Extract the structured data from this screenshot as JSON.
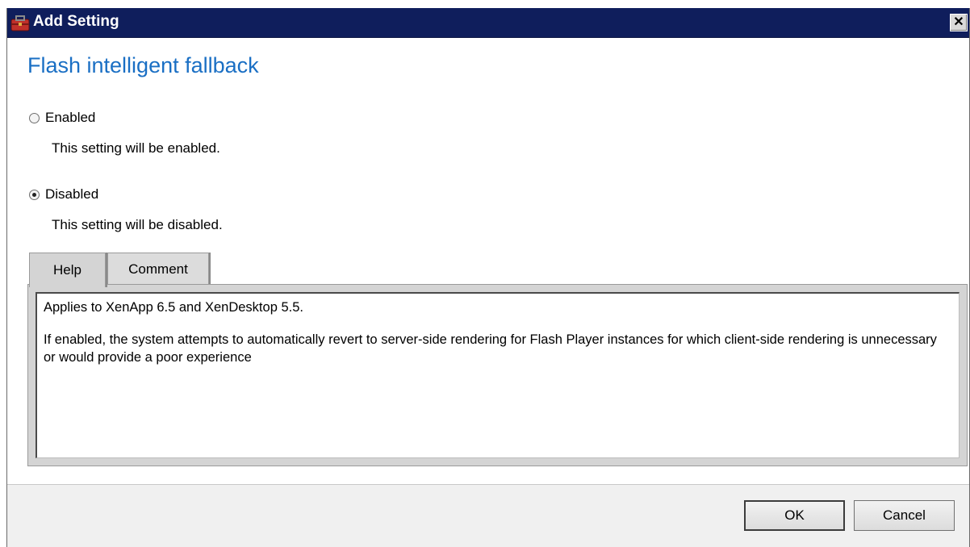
{
  "window": {
    "title": "Add Setting",
    "close_symbol": "✕",
    "icon": "settings-toolbox-icon"
  },
  "setting": {
    "name": "Flash intelligent fallback"
  },
  "options": [
    {
      "label": "Enabled",
      "description": "This setting will be enabled.",
      "selected": false
    },
    {
      "label": "Disabled",
      "description": "This setting will be disabled.",
      "selected": true
    }
  ],
  "tabs": [
    {
      "label": "Help",
      "active": true
    },
    {
      "label": "Comment",
      "active": false
    }
  ],
  "help": {
    "line1": "Applies to XenApp 6.5 and XenDesktop 5.5.",
    "line2": "If enabled, the system attempts to automatically revert to server-side rendering for Flash Player instances for which client-side rendering is unnecessary or would provide a poor experience"
  },
  "buttons": {
    "ok": "OK",
    "cancel": "Cancel"
  },
  "colors": {
    "titlebar": "#0f1e5c",
    "heading": "#1a6fc4"
  }
}
